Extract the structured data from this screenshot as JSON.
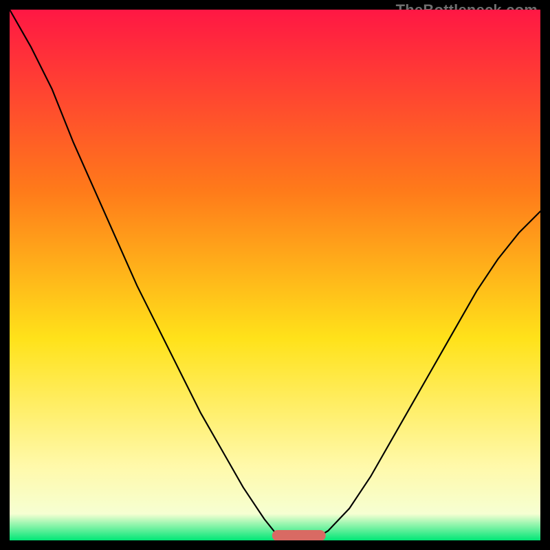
{
  "watermark": "TheBottleneck.com",
  "colors": {
    "background": "#000000",
    "gradient_top": "#ff1744",
    "gradient_mid_upper": "#ff7a1a",
    "gradient_mid": "#ffe21a",
    "gradient_low": "#fff9aa",
    "gradient_base": "#f6ffd2",
    "gradient_bottom": "#00e676",
    "curve": "#000000",
    "marker": "#d96a63"
  },
  "chart_data": {
    "type": "line",
    "title": "",
    "xlabel": "",
    "ylabel": "",
    "xlim": [
      0,
      100
    ],
    "ylim": [
      0,
      100
    ],
    "grid": false,
    "series": [
      {
        "name": "bottleneck-curve",
        "x": [
          0,
          4,
          8,
          12,
          16,
          20,
          24,
          28,
          32,
          36,
          40,
          44,
          48,
          50,
          52,
          54,
          56,
          58,
          60,
          64,
          68,
          72,
          76,
          80,
          84,
          88,
          92,
          96,
          100
        ],
        "y": [
          100,
          93,
          85,
          75,
          66,
          57,
          48,
          40,
          32,
          24,
          17,
          10,
          4,
          1.5,
          0.6,
          0.3,
          0.3,
          0.6,
          1.8,
          6,
          12,
          19,
          26,
          33,
          40,
          47,
          53,
          58,
          62
        ]
      }
    ],
    "markers": [
      {
        "name": "optimal-zone",
        "x_range": [
          50.5,
          58.5
        ],
        "y": 0.9,
        "thickness": 2.1
      }
    ]
  }
}
